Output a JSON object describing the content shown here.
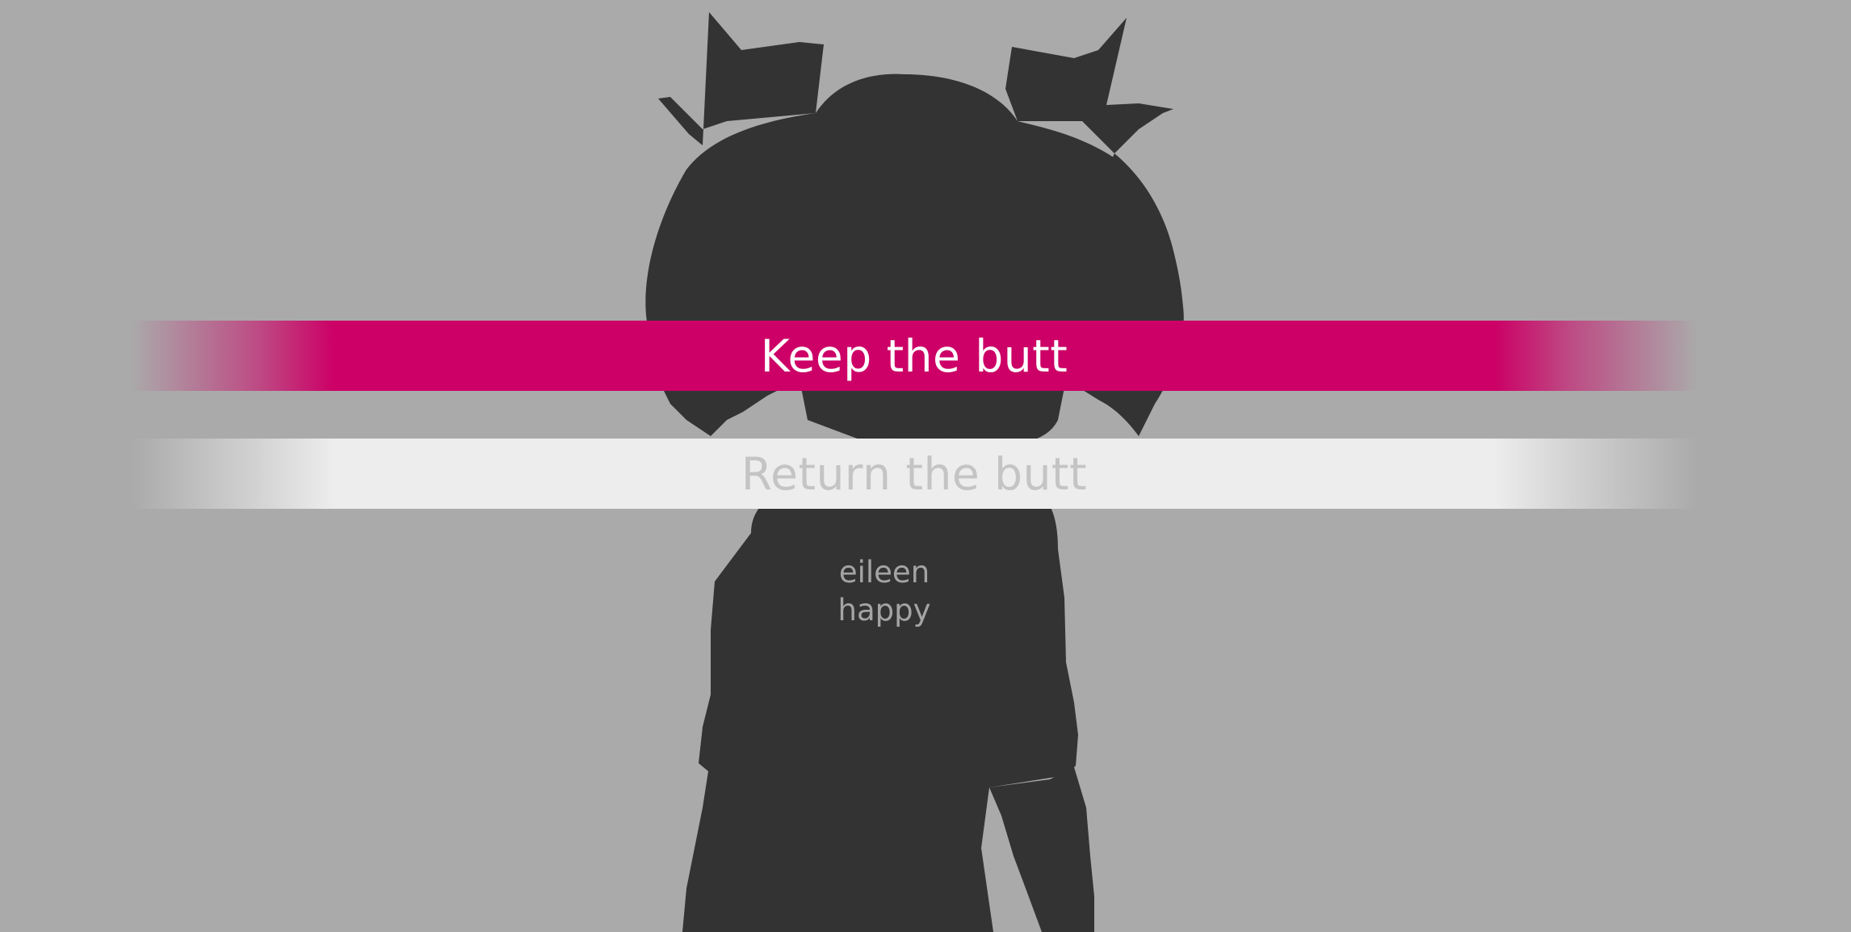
{
  "scene": {
    "background_color": "#aaaaaa",
    "sprite": {
      "name_line": "eileen",
      "expression_line": "happy",
      "silhouette_color": "#333333"
    }
  },
  "menu": {
    "choices": [
      {
        "label": "Keep the butt",
        "state": "selected",
        "color": "#cc0066"
      },
      {
        "label": "Return the butt",
        "state": "idle",
        "color": "#ededed"
      }
    ]
  }
}
